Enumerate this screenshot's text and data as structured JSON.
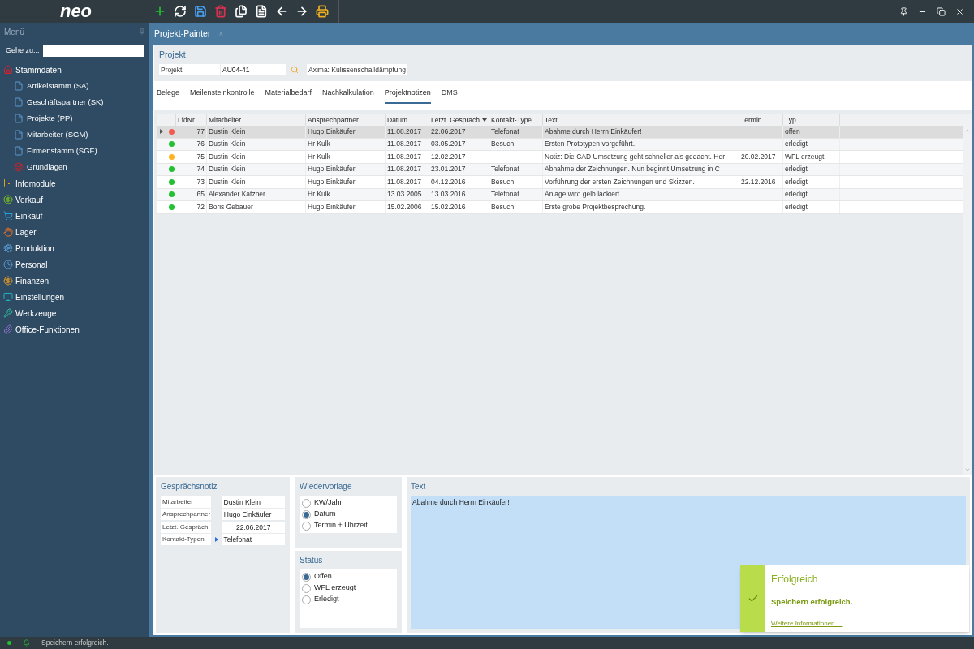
{
  "app": {
    "logo": "neo"
  },
  "sidebar": {
    "title": "Menü",
    "goto_label": "Gehe zu...",
    "items": [
      {
        "label": "Stammdaten",
        "kind": "home",
        "children": [
          {
            "label": "Artikelstamm (SA)",
            "kind": "file"
          },
          {
            "label": "Geschäftspartner (SK)",
            "kind": "file"
          },
          {
            "label": "Projekte (PP)",
            "kind": "file"
          },
          {
            "label": "Mitarbeiter (SGM)",
            "kind": "file"
          },
          {
            "label": "Firmenstamm (SGF)",
            "kind": "file"
          },
          {
            "label": "Grundlagen",
            "kind": "stack"
          }
        ]
      },
      {
        "label": "Infomodule",
        "kind": "chart"
      },
      {
        "label": "Verkauf",
        "kind": "cycle"
      },
      {
        "label": "Einkauf",
        "kind": "cart"
      },
      {
        "label": "Lager",
        "kind": "hand"
      },
      {
        "label": "Produktion",
        "kind": "gears"
      },
      {
        "label": "Personal",
        "kind": "clock"
      },
      {
        "label": "Finanzen",
        "kind": "money"
      },
      {
        "label": "Einstellungen",
        "kind": "monitor"
      },
      {
        "label": "Werkzeuge",
        "kind": "tools"
      },
      {
        "label": "Office-Funktionen",
        "kind": "clip"
      }
    ]
  },
  "document_tab": {
    "title": "Projekt-Painter",
    "close": "×"
  },
  "projekt": {
    "heading": "Projekt",
    "label": "Projekt",
    "value": "AU04-41",
    "description": "Axima: Kulissenschalldämpfung"
  },
  "tabs": [
    {
      "label": "Belege",
      "selected": false
    },
    {
      "label": "Meilensteinkontrolle",
      "selected": false
    },
    {
      "label": "Materialbedarf",
      "selected": false
    },
    {
      "label": "Nachkalkulation",
      "selected": false
    },
    {
      "label": "Projektnotizen",
      "selected": true
    },
    {
      "label": "DMS",
      "selected": false
    }
  ],
  "table": {
    "columns": [
      {
        "label": "LfdNr",
        "sorted": false
      },
      {
        "label": "Mitarbeiter",
        "sorted": false
      },
      {
        "label": "Ansprechpartner",
        "sorted": false
      },
      {
        "label": "Datum",
        "sorted": false
      },
      {
        "label": "Letzt. Gespräch",
        "sorted": true
      },
      {
        "label": "Kontakt-Type",
        "sorted": false
      },
      {
        "label": "Text",
        "sorted": false
      },
      {
        "label": "Termin",
        "sorted": false
      },
      {
        "label": "Typ",
        "sorted": false
      }
    ],
    "rows": [
      {
        "selected": true,
        "color": "#f05a50",
        "cells": [
          "77",
          "Dustin Klein",
          "Hugo Einkäufer",
          "11.08.2017",
          "22.06.2017",
          "Telefonat",
          "Abahme durch Herrn Einkäufer!",
          "",
          "offen"
        ]
      },
      {
        "selected": false,
        "color": "#22c032",
        "cells": [
          "76",
          "Dustin Klein",
          "Hr Kulk",
          "11.08.2017",
          "03.05.2017",
          "Besuch",
          "Ersten Prototypen vorgeführt.",
          "",
          "erledigt"
        ]
      },
      {
        "selected": false,
        "color": "#ffb21f",
        "cells": [
          "75",
          "Dustin Klein",
          "Hr Kulk",
          "11.08.2017",
          "12.02.2017",
          "",
          "Notiz: Die CAD Umsetzung geht schneller als gedacht. Her",
          "20.02.2017",
          "WFL erzeugt"
        ]
      },
      {
        "selected": false,
        "color": "#22c032",
        "cells": [
          "74",
          "Dustin Klein",
          "Hugo Einkäufer",
          "11.08.2017",
          "23.01.2017",
          "Telefonat",
          "Abnahme der Zeichnungen. Nun beginnt Umsetzung in C",
          "",
          "erledigt"
        ]
      },
      {
        "selected": false,
        "color": "#22c032",
        "cells": [
          "73",
          "Dustin Klein",
          "Hugo Einkäufer",
          "11.08.2017",
          "04.12.2016",
          "Besuch",
          "Vorführung der ersten Zeichnungen und Skizzen.",
          "22.12.2016",
          "erledigt"
        ]
      },
      {
        "selected": false,
        "color": "#22c032",
        "cells": [
          "65",
          "Alexander Katzner",
          "Hr Kulk",
          "13.03.2005",
          "13.03.2016",
          "Telefonat",
          "Anlage wird gelb lackiert",
          "",
          "erledigt"
        ]
      },
      {
        "selected": false,
        "color": "#22c032",
        "cells": [
          "72",
          "Boris Gebauer",
          "Hugo Einkäufer",
          "15.02.2006",
          "15.02.2016",
          "Besuch",
          "Erste grobe Projektbesprechung.",
          "",
          "erledigt"
        ]
      }
    ]
  },
  "gespraechsnotiz": {
    "heading": "Gesprächsnotiz",
    "fields": [
      {
        "label": "Mitarbeiter",
        "value": "Dustin Klein",
        "marker": false
      },
      {
        "label": "Ansprechpartner",
        "value": "Hugo Einkäufer",
        "marker": false
      },
      {
        "label": "Letzt. Gespräch",
        "value": "22.06.2017",
        "marker": false
      },
      {
        "label": "Kontakt-Typen",
        "value": "Telefonat",
        "marker": true
      }
    ]
  },
  "wiedervorlage": {
    "heading": "Wiedervorlage",
    "options": [
      {
        "label": "KW/Jahr",
        "selected": false
      },
      {
        "label": "Datum",
        "selected": true
      },
      {
        "label": "Termin + Uhrzeit",
        "selected": false
      }
    ]
  },
  "status": {
    "heading": "Status",
    "options": [
      {
        "label": "Offen",
        "selected": true
      },
      {
        "label": "WFL erzeugt",
        "selected": false
      },
      {
        "label": "Erledigt",
        "selected": false
      }
    ]
  },
  "text_panel": {
    "heading": "Text",
    "value": "Abahme durch Herrn Einkäufer!"
  },
  "toast": {
    "title": "Erfolgreich",
    "message": "Speichern erfolgreich.",
    "link": "Weitere Informationen ..."
  },
  "status_bar": {
    "message": "Speichern erfolgreich."
  }
}
